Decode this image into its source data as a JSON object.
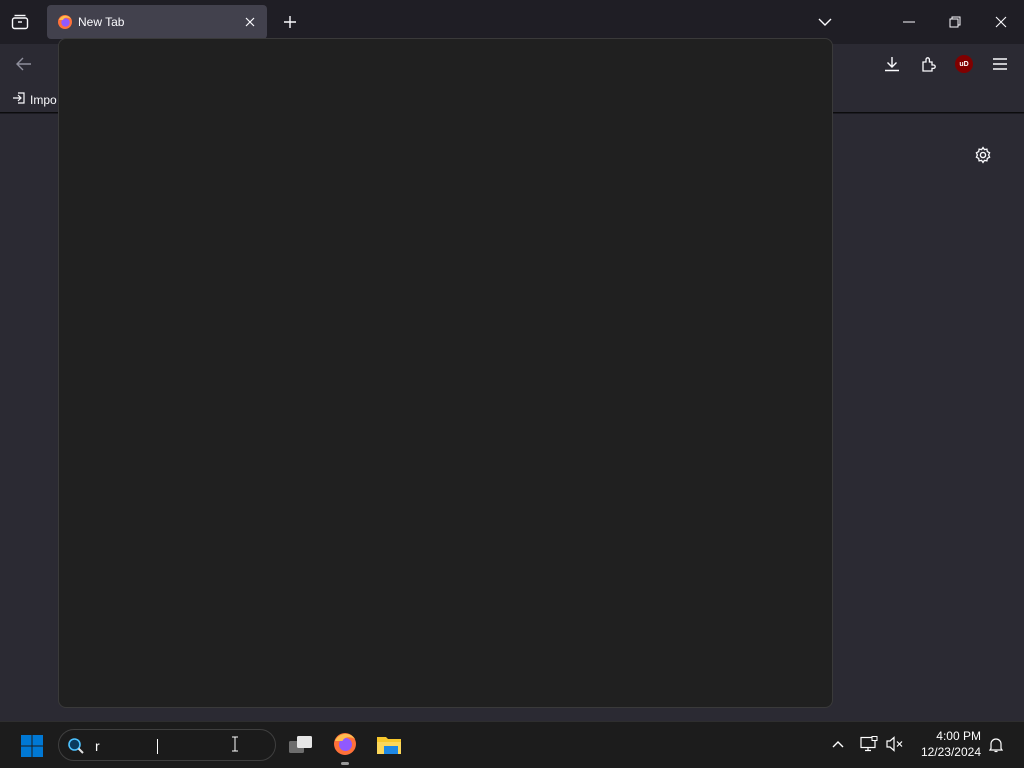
{
  "browser": {
    "tab": {
      "title": "New Tab",
      "favicon": "firefox-icon"
    },
    "bookmarks": [
      {
        "label": "Impo",
        "icon": "import-icon"
      }
    ],
    "icons": [
      "tab-list-icon",
      "back-icon",
      "download-icon",
      "extensions-icon",
      "ublock-icon",
      "menu-icon",
      "gear-icon",
      "chevron-down-icon",
      "new-tab-icon",
      "minimize-icon",
      "restore-icon",
      "close-icon"
    ],
    "ublock_label": "uD"
  },
  "taskbar": {
    "search_value": "r",
    "time": "4:00 PM",
    "date": "12/23/2024",
    "icons": [
      "windows-start-icon",
      "search-icon",
      "task-view-icon",
      "firefox-icon",
      "file-explorer-icon",
      "chevron-up-icon",
      "network-icon",
      "volume-muted-icon",
      "notification-bell-icon"
    ]
  },
  "colors": {
    "accent_blue": "#0078d4",
    "ublock_red": "#800000",
    "panel_bg": "#202020"
  }
}
